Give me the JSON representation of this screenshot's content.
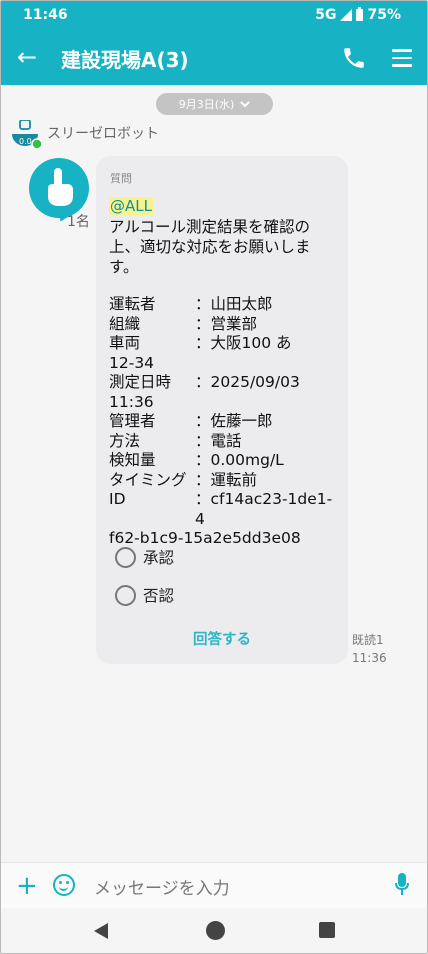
{
  "status": {
    "time": "11:46",
    "network": "5G",
    "battery": "75%"
  },
  "header": {
    "title": "建設現場A(3)",
    "back_icon": "arrow-left-icon",
    "phone_icon": "phone-icon",
    "menu_icon": "hamburger-menu-icon"
  },
  "date_pill": {
    "label": "9月3日(水)"
  },
  "bot": {
    "name": "スリーゼロボット"
  },
  "message": {
    "read_count": "1名",
    "question_label": "質問",
    "mention": "@ALL",
    "body": "アルコール測定結果を確認の上、適切な対応をお願いします。",
    "fields": [
      {
        "key": "運転者",
        "value": "：山田太郎"
      },
      {
        "key": "組織",
        "value": "：営業部"
      },
      {
        "key": "車両",
        "value": "：大阪100 あ"
      },
      {
        "key": "",
        "value": "12-34"
      },
      {
        "key": "測定日時",
        "value": "：2025/09/03"
      },
      {
        "key": "",
        "value": "11:36"
      },
      {
        "key": "管理者",
        "value": "：佐藤一郎"
      },
      {
        "key": "方法",
        "value": "：電話"
      },
      {
        "key": "検知量",
        "value": "：0.00mg/L"
      },
      {
        "key": "タイミング",
        "value": "：運転前"
      },
      {
        "key": "ID",
        "value": "：cf14ac23-1de1-4"
      },
      {
        "key": "",
        "value": "f62-b1c9-15a2e5dd3e08"
      }
    ],
    "options": [
      "承認",
      "否認"
    ],
    "answer_button": "回答する",
    "read_label": "既読1",
    "sent_time": "11:36"
  },
  "input": {
    "placeholder": "メッセージを入力"
  },
  "colors": {
    "accent": "#17b2c3",
    "bubble": "#ececee",
    "mention_bg": "#f6f38e"
  }
}
